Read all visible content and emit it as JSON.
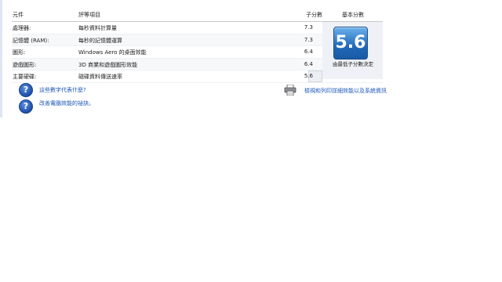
{
  "headers": {
    "component": "元件",
    "rated_item": "評等項目",
    "subscore": "子分數",
    "base_score": "基本分數"
  },
  "rows": [
    {
      "component": "處理器:",
      "item": "每秒資料計算量",
      "score": "7.3"
    },
    {
      "component": "記憶體 (RAM):",
      "item": "每秒的記憶體運算",
      "score": "7.3"
    },
    {
      "component": "圖形:",
      "item": "Windows Aero 的桌面效能",
      "score": "6.4"
    },
    {
      "component": "遊戲圖形:",
      "item": "3D 商業和遊戲圖形效能",
      "score": "6.4"
    },
    {
      "component": "主要硬碟:",
      "item": "磁碟資料傳送速率",
      "score": "5.6"
    }
  ],
  "base_score": {
    "value": "5.6",
    "caption": "由最低子分數決定"
  },
  "links": {
    "what_numbers_mean": "這些數字代表什麼?",
    "improve_performance": "改善電腦效能的祕訣。",
    "view_print": "檢視和列印詳細效能以及系統資訊"
  },
  "icons": {
    "help": "help-icon",
    "printer": "printer-icon"
  },
  "colors": {
    "link": "#1a56b8",
    "badge": "#2168b8"
  }
}
